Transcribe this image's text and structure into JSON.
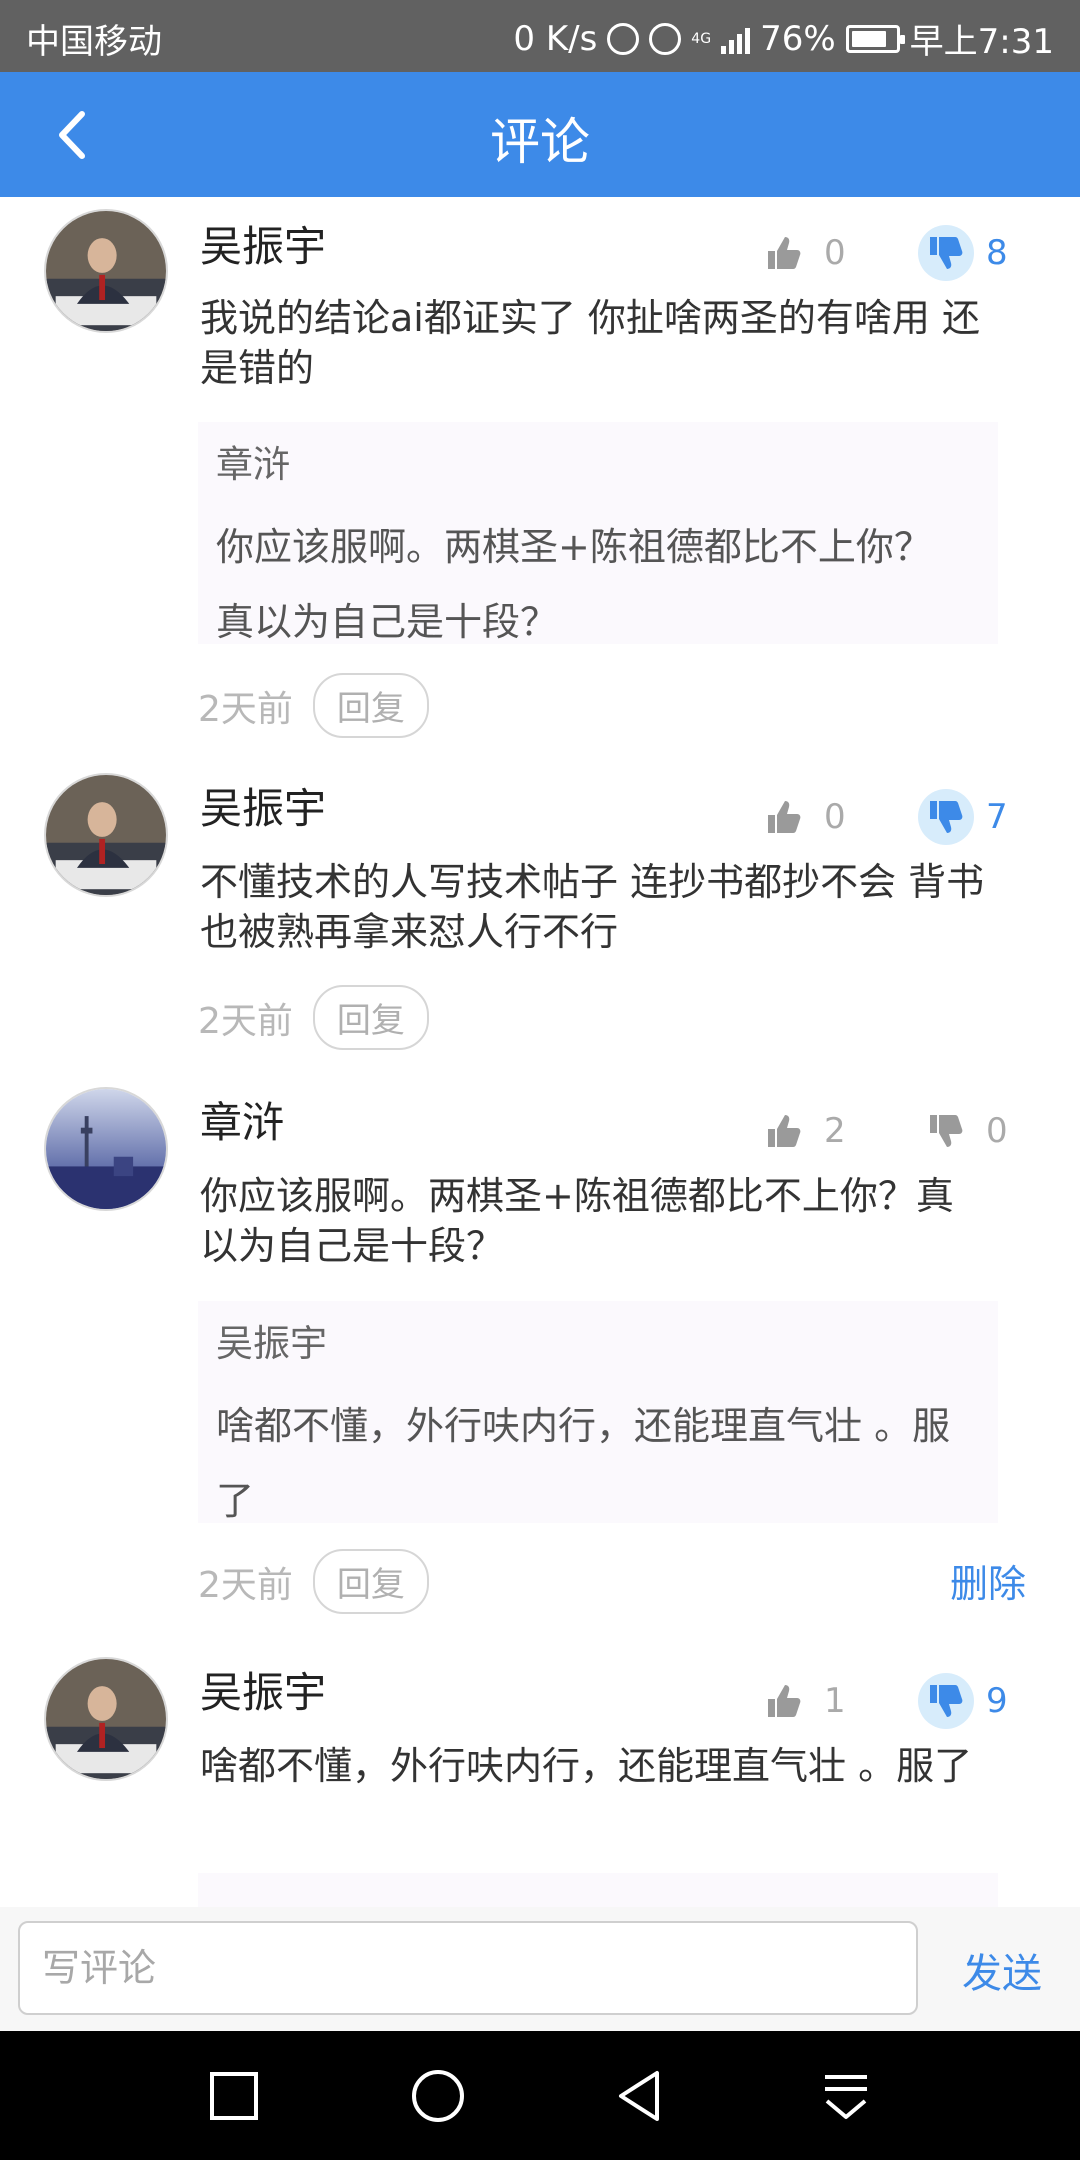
{
  "status_bar": {
    "carrier": "中国移动",
    "speed": "0 K/s",
    "network": "4G",
    "battery": "76%",
    "time": "早上7:31",
    "icons": [
      "data-saver-icon",
      "alarm-icon",
      "signal-icon",
      "battery-icon"
    ]
  },
  "header": {
    "title": "评论",
    "back_icon": "chevron-left-icon"
  },
  "colors": {
    "primary": "#3d8ae8",
    "like_active_bg": "#d7ecfb",
    "muted": "#aaaaaa"
  },
  "comments": [
    {
      "author": "吴振宇",
      "likes": "0",
      "dislikes": "8",
      "disliked": true,
      "text": "我说的结论ai都证实了 你扯啥两圣的有啥用 还是错的",
      "quote": {
        "author": "章浒",
        "text": "你应该服啊。两棋圣+陈祖德都比不上你？真以为自己是十段？"
      },
      "time": "2天前",
      "reply_label": "回复"
    },
    {
      "author": "吴振宇",
      "likes": "0",
      "dislikes": "7",
      "disliked": true,
      "text": "不懂技术的人写技术帖子 连抄书都抄不会 背书也被熟再拿来怼人行不行",
      "time": "2天前",
      "reply_label": "回复"
    },
    {
      "author": "章浒",
      "likes": "2",
      "dislikes": "0",
      "disliked": false,
      "text": "你应该服啊。两棋圣+陈祖德都比不上你？真以为自己是十段？",
      "quote": {
        "author": "吴振宇",
        "text": "啥都不懂，外行呋内行，还能理直气壮 。服了"
      },
      "time": "2天前",
      "reply_label": "回复",
      "delete_label": "删除"
    },
    {
      "author": "吴振宇",
      "likes": "1",
      "dislikes": "9",
      "disliked": true,
      "text": "啥都不懂，外行呋内行，还能理直气壮 。服了"
    }
  ],
  "input": {
    "placeholder": "写评论",
    "value": "",
    "send_label": "发送"
  },
  "nav_bar": {
    "icons": [
      "recent-apps-icon",
      "home-icon",
      "back-triangle-icon",
      "notification-pulldown-icon"
    ]
  }
}
